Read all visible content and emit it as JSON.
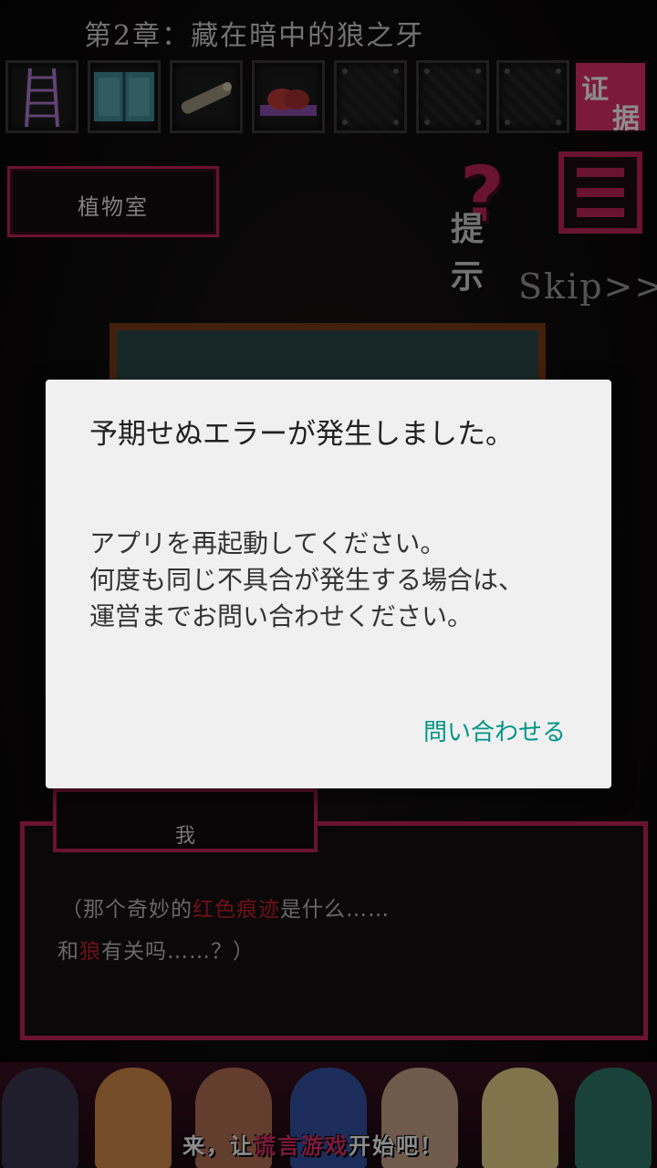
{
  "header": {
    "chapter_title": "第2章：藏在暗中的狼之牙",
    "evidence_label_1": "证",
    "evidence_label_2": "据"
  },
  "inventory": {
    "slots": [
      {
        "icon": "ladder-icon",
        "state": "item"
      },
      {
        "icon": "book-icon",
        "state": "item"
      },
      {
        "icon": "scroll-icon",
        "state": "item"
      },
      {
        "icon": "meat-on-tray-icon",
        "state": "item"
      },
      {
        "icon": "empty-slot-icon",
        "state": "empty"
      },
      {
        "icon": "empty-slot-icon",
        "state": "empty"
      },
      {
        "icon": "empty-slot-icon",
        "state": "empty"
      }
    ]
  },
  "location": {
    "label": "植物室"
  },
  "controls": {
    "hint_label": "提 示",
    "skip_label": "Skip>>"
  },
  "dialog": {
    "speaker": "我",
    "line1_pre": "（那个奇妙的",
    "line1_hl": "红色痕迹",
    "line1_post": "是什么……",
    "line2_pre": "和",
    "line2_hl": "狼",
    "line2_post": "有关吗……？）"
  },
  "banner": {
    "pre": "来，让",
    "hl": "谎言游戏",
    "post": "开始吧！"
  },
  "alert": {
    "title": "予期せぬエラーが発生しました。",
    "message": "アプリを再起動してください。\n何度も同じ不具合が発生する場合は、運営までお問い合わせください。",
    "action": "問い合わせる"
  },
  "colors": {
    "accent": "#c2245a",
    "alert_action": "#009688",
    "highlight": "#c8202a"
  }
}
